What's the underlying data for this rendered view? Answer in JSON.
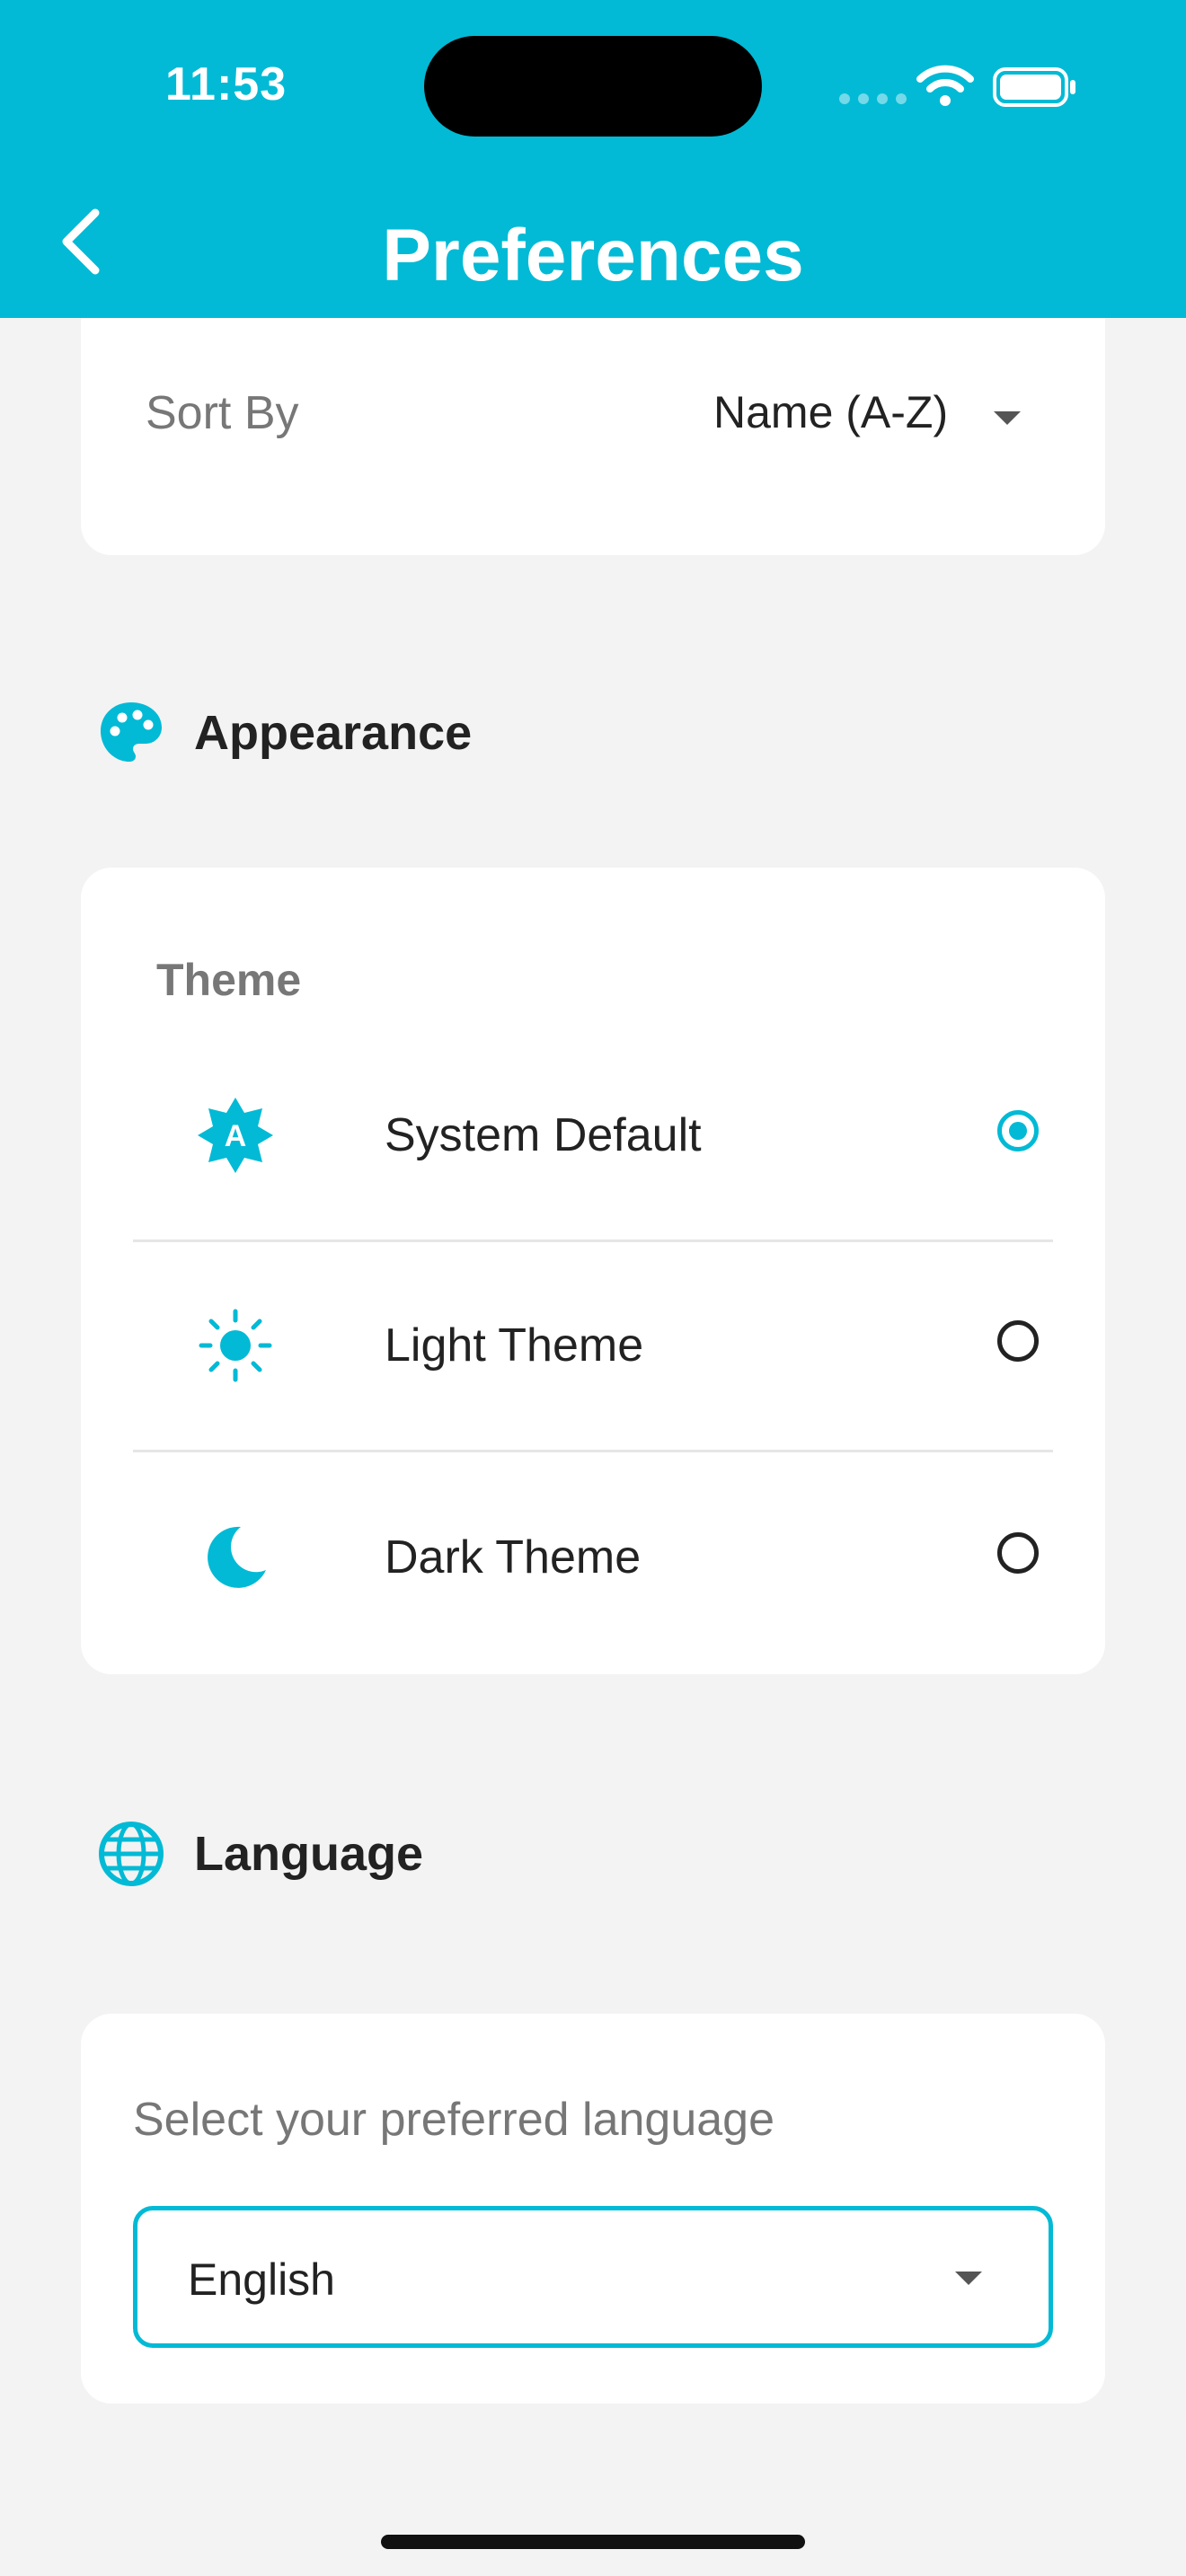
{
  "status_bar": {
    "time": "11:53"
  },
  "header": {
    "title": "Preferences",
    "back_icon": "chevron-left-icon"
  },
  "sorting": {
    "label": "Sort By",
    "value": "Name (A-Z)"
  },
  "appearance": {
    "section_title": "Appearance",
    "section_icon": "palette-icon",
    "theme_heading": "Theme",
    "options": [
      {
        "label": "System Default",
        "icon": "auto-brightness-icon",
        "selected": true
      },
      {
        "label": "Light Theme",
        "icon": "sun-icon",
        "selected": false
      },
      {
        "label": "Dark Theme",
        "icon": "moon-icon",
        "selected": false
      }
    ]
  },
  "language": {
    "section_title": "Language",
    "section_icon": "globe-icon",
    "prompt": "Select your preferred language",
    "value": "English"
  },
  "colors": {
    "accent": "#02bad5",
    "background": "#f3f3f3",
    "card": "#ffffff",
    "text_primary": "#222222",
    "text_secondary": "#777777"
  }
}
